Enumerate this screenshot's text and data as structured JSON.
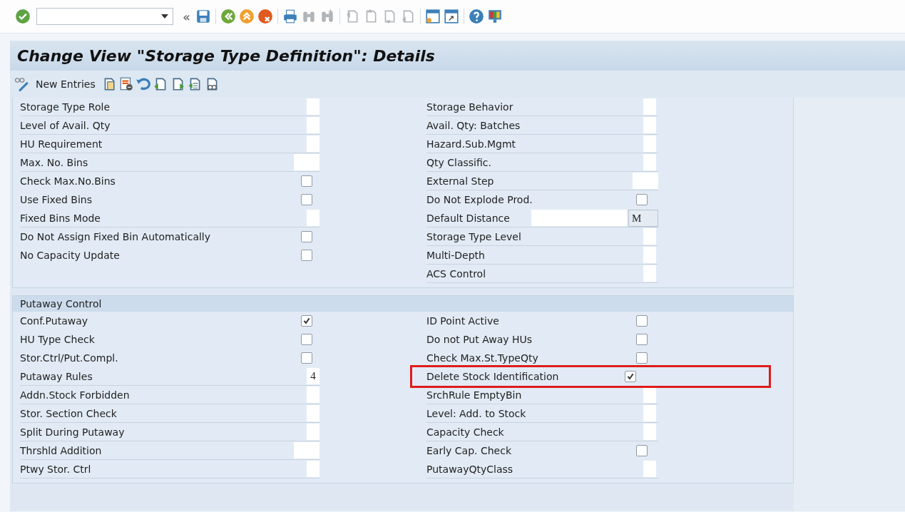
{
  "toolbar": {
    "collapse_glyph": "«"
  },
  "title": "Change View \"Storage Type Definition\": Details",
  "app_toolbar": {
    "new_entries": "New Entries"
  },
  "sections": [
    {
      "left": [
        {
          "label": "Storage Type Role",
          "kind": "char"
        },
        {
          "label": "Level of Avail. Qty",
          "kind": "char"
        },
        {
          "label": "HU Requirement",
          "kind": "char"
        },
        {
          "label": "Max. No. Bins",
          "kind": "field"
        },
        {
          "label": "Check Max.No.Bins",
          "kind": "checkbox",
          "checked": false
        },
        {
          "label": "Use Fixed Bins",
          "kind": "checkbox",
          "checked": false
        },
        {
          "label": "Fixed Bins Mode",
          "kind": "char"
        },
        {
          "label": "Do Not Assign Fixed Bin Automatically",
          "kind": "checkbox",
          "checked": false
        },
        {
          "label": "No Capacity Update",
          "kind": "checkbox",
          "checked": false
        }
      ],
      "right": [
        {
          "label": "Storage Behavior",
          "kind": "char"
        },
        {
          "label": "Avail. Qty: Batches",
          "kind": "char"
        },
        {
          "label": "Hazard.Sub.Mgmt",
          "kind": "char"
        },
        {
          "label": "Qty Classific.",
          "kind": "char"
        },
        {
          "label": "External Step",
          "kind": "field"
        },
        {
          "label": "Do Not Explode Prod.",
          "kind": "checkbox",
          "checked": false
        },
        {
          "label": "Default Distance",
          "kind": "field_unit",
          "unit": "M"
        },
        {
          "label": "Storage Type Level",
          "kind": "char"
        },
        {
          "label": "Multi-Depth",
          "kind": "char"
        },
        {
          "label": "ACS Control",
          "kind": "char"
        }
      ]
    },
    {
      "header": "Putaway Control",
      "left": [
        {
          "label": "Conf.Putaway",
          "kind": "checkbox",
          "checked": true
        },
        {
          "label": "HU Type Check",
          "kind": "checkbox",
          "checked": false
        },
        {
          "label": "Stor.Ctrl/Put.Compl.",
          "kind": "checkbox",
          "checked": false
        },
        {
          "label": "Putaway Rules",
          "kind": "char",
          "value": "4"
        },
        {
          "label": "Addn.Stock Forbidden",
          "kind": "char"
        },
        {
          "label": "Stor. Section Check",
          "kind": "char"
        },
        {
          "label": "Split During Putaway",
          "kind": "char"
        },
        {
          "label": "Thrshld Addition",
          "kind": "field"
        },
        {
          "label": "Ptwy Stor. Ctrl",
          "kind": "char"
        }
      ],
      "right": [
        {
          "label": "ID Point Active",
          "kind": "checkbox",
          "checked": false
        },
        {
          "label": "Do not Put Away HUs",
          "kind": "checkbox",
          "checked": false
        },
        {
          "label": "Check Max.St.TypeQty",
          "kind": "checkbox",
          "checked": false
        },
        {
          "label": "Delete Stock Identification",
          "kind": "checkbox",
          "checked": true,
          "highlighted": true
        },
        {
          "label": "SrchRule EmptyBin",
          "kind": "char"
        },
        {
          "label": "Level: Add. to Stock",
          "kind": "char"
        },
        {
          "label": "Capacity Check",
          "kind": "char"
        },
        {
          "label": "Early Cap. Check",
          "kind": "checkbox",
          "checked": false
        },
        {
          "label": "PutawayQtyClass",
          "kind": "char"
        }
      ]
    }
  ]
}
